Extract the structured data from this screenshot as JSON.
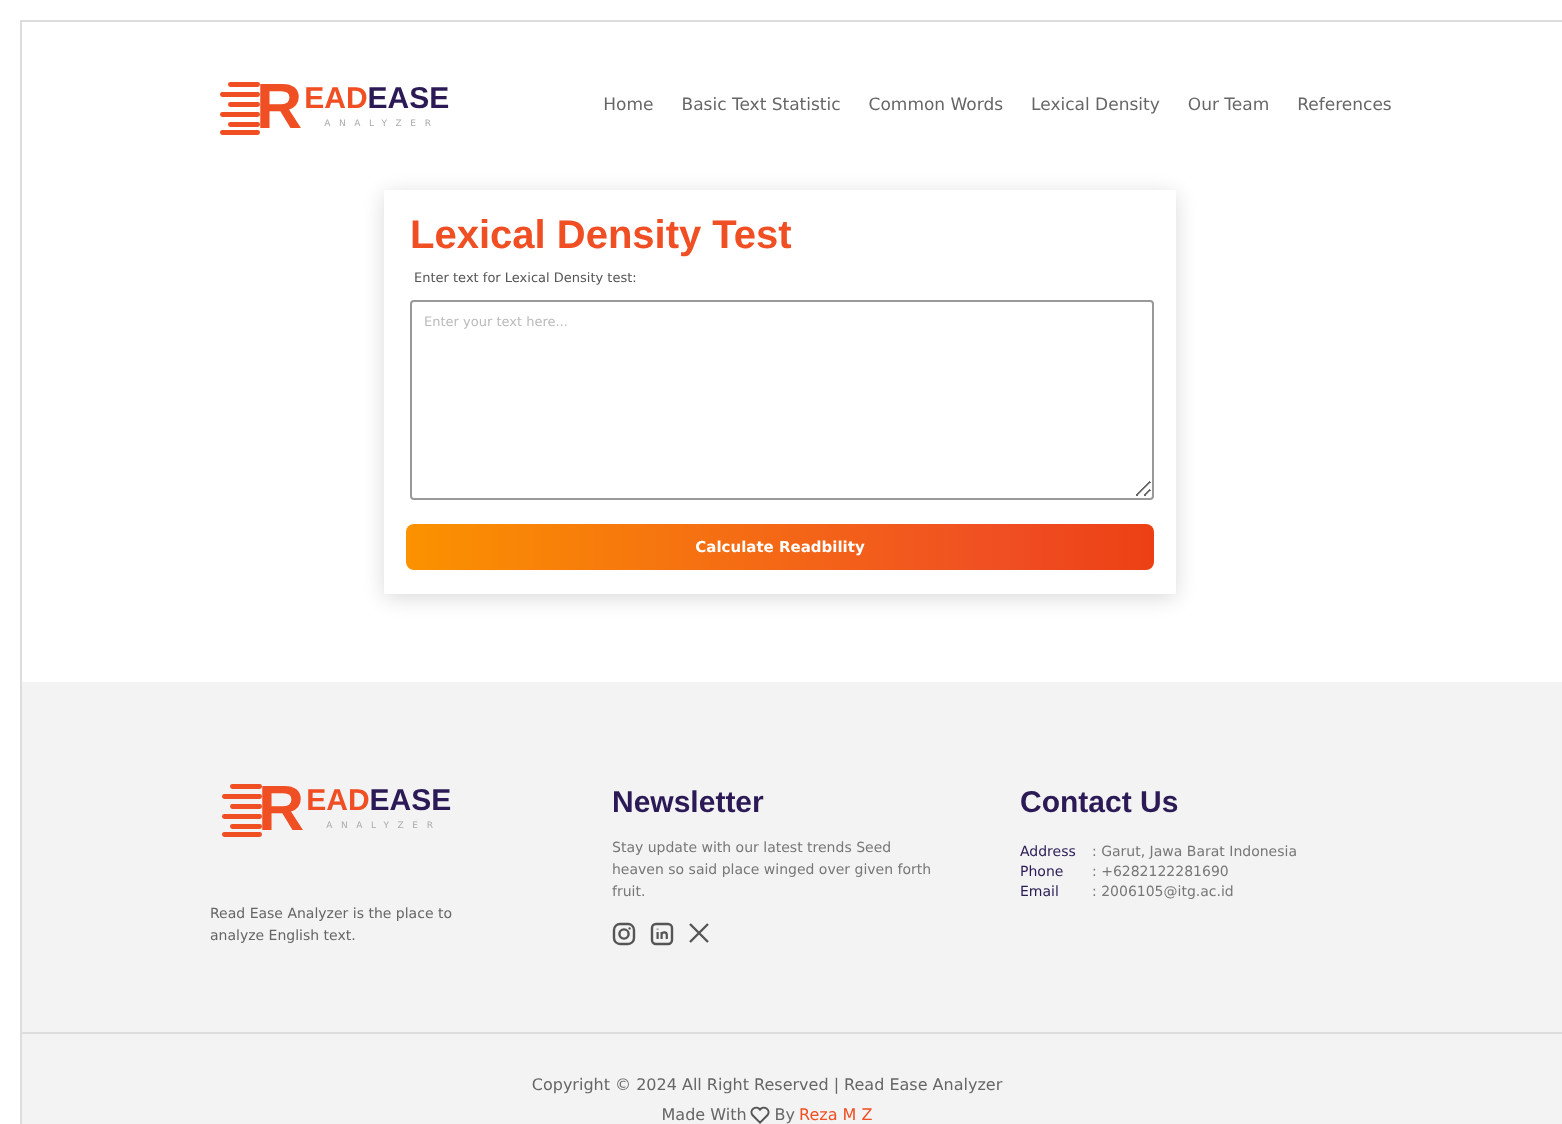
{
  "header_logo": {
    "mark": "R",
    "word_a": "EAD",
    "word_b": "EASE",
    "tagline": "ANALYZER"
  },
  "nav": [
    {
      "label": "Home"
    },
    {
      "label": "Basic Text Statistic"
    },
    {
      "label": "Common Words"
    },
    {
      "label": "Lexical Density"
    },
    {
      "label": "Our Team"
    },
    {
      "label": "References"
    }
  ],
  "card": {
    "title": "Lexical Density Test",
    "field_label": "Enter text for Lexical Density test:",
    "placeholder": "Enter your text here...",
    "button": "Calculate Readbility"
  },
  "footer": {
    "logo": {
      "mark": "R",
      "word_a": "EAD",
      "word_b": "EASE",
      "tagline": "ANALYZER"
    },
    "about": "Read Ease Analyzer is the place to analyze English text.",
    "newsletter": {
      "title": "Newsletter",
      "text": "Stay update with our latest trends Seed heaven so said place winged over given forth fruit.",
      "socials": [
        {
          "kind": "instagram"
        },
        {
          "kind": "linkedin"
        },
        {
          "kind": "x"
        }
      ]
    },
    "contact": {
      "title": "Contact Us",
      "rows": [
        {
          "label": "Address",
          "value": ": Garut, Jawa Barat Indonesia"
        },
        {
          "label": "Phone",
          "value": ": +6282122281690"
        },
        {
          "label": "Email",
          "value": ": 2006105@itg.ac.id"
        }
      ]
    },
    "copyright": "Copyright © 2024 All Right Reserved | Read Ease Analyzer",
    "made_with": "Made With",
    "by": "By",
    "author": "Reza M Z"
  }
}
